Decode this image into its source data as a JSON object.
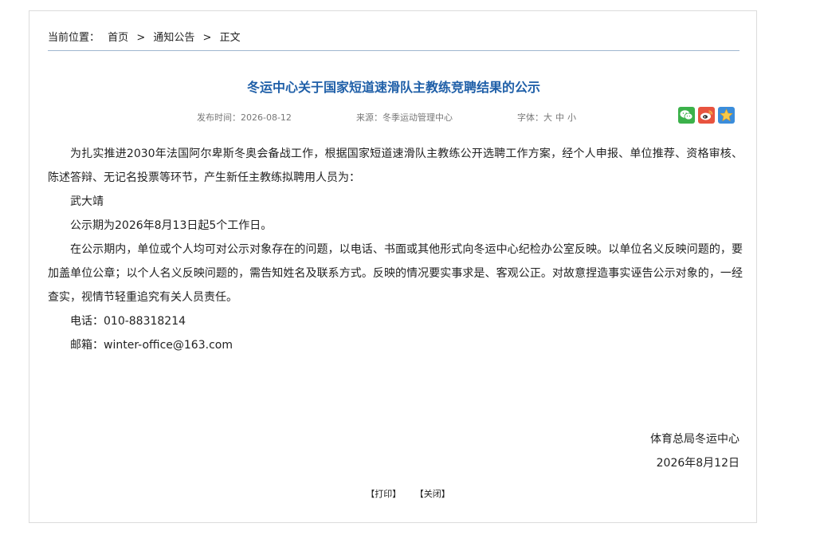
{
  "breadcrumb": {
    "prefix": "当前位置：",
    "items": [
      "首页",
      "通知公告",
      "正文"
    ],
    "separator": ">"
  },
  "article": {
    "title": "冬运中心关于国家短道速滑队主教练竞聘结果的公示",
    "meta": {
      "publish_label": "发布时间：",
      "publish_date": "2026-08-12",
      "source_label": "来源：",
      "source": "冬季运动管理中心",
      "font_label": "字体：",
      "font_options": [
        "大",
        "中",
        "小"
      ]
    },
    "share": [
      {
        "name": "wechat-icon",
        "color": "#3bb14a"
      },
      {
        "name": "weibo-icon",
        "color": "#e8533f"
      },
      {
        "name": "favorite-star-icon",
        "color": "#3b8ddb"
      }
    ],
    "paragraphs": [
      "为扎实推进2030年法国阿尔卑斯冬奥会备战工作，根据国家短道速滑队主教练公开选聘工作方案，经个人申报、单位推荐、资格审核、陈述答辩、无记名投票等环节，产生新任主教练拟聘用人员为：",
      "武大靖",
      "公示期为2026年8月13日起5个工作日。",
      "在公示期内，单位或个人均可对公示对象存在的问题，以电话、书面或其他形式向冬运中心纪检办公室反映。以单位名义反映问题的，要加盖单位公章；以个人名义反映问题的，需告知姓名及联系方式。反映的情况要实事求是、客观公正。对故意捏造事实诬告公示对象的，一经查实，视情节轻重追究有关人员责任。",
      "电话：010-88318214",
      "邮箱：winter-office@163.com"
    ],
    "signature": {
      "org": "体育总局冬运中心",
      "date": "2026年8月12日"
    }
  },
  "actions": {
    "print": "【打印】",
    "close": "【关闭】"
  }
}
